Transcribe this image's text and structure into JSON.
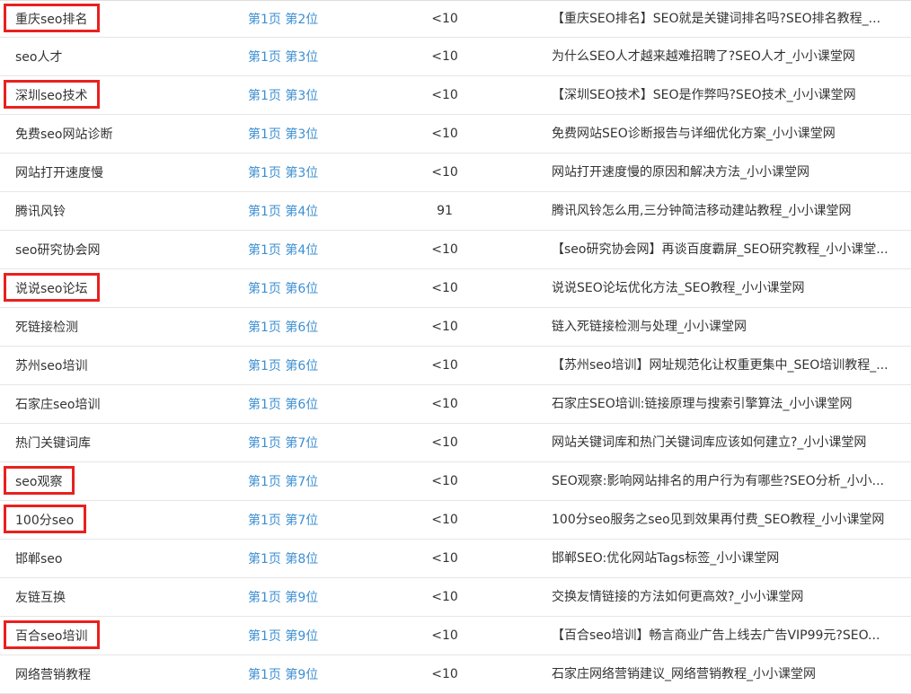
{
  "colors": {
    "link": "#3d8fd1",
    "text": "#333333",
    "highlight_box": "#e8211e",
    "row_border": "#e6e6e6"
  },
  "rows": [
    {
      "keyword": "重庆seo排名",
      "rank": "第1页 第2位",
      "index": "<10",
      "title": "【重庆SEO排名】SEO就是关键词排名吗?SEO排名教程_...",
      "highlighted": true
    },
    {
      "keyword": "seo人才",
      "rank": "第1页 第3位",
      "index": "<10",
      "title": "为什么SEO人才越来越难招聘了?SEO人才_小小课堂网",
      "highlighted": false
    },
    {
      "keyword": "深圳seo技术",
      "rank": "第1页 第3位",
      "index": "<10",
      "title": "【深圳SEO技术】SEO是作弊吗?SEO技术_小小课堂网",
      "highlighted": true
    },
    {
      "keyword": "免费seo网站诊断",
      "rank": "第1页 第3位",
      "index": "<10",
      "title": "免费网站SEO诊断报告与详细优化方案_小小课堂网",
      "highlighted": false
    },
    {
      "keyword": "网站打开速度慢",
      "rank": "第1页 第3位",
      "index": "<10",
      "title": "网站打开速度慢的原因和解决方法_小小课堂网",
      "highlighted": false
    },
    {
      "keyword": "腾讯风铃",
      "rank": "第1页 第4位",
      "index": "91",
      "title": "腾讯风铃怎么用,三分钟简洁移动建站教程_小小课堂网",
      "highlighted": false
    },
    {
      "keyword": "seo研究协会网",
      "rank": "第1页 第4位",
      "index": "<10",
      "title": "【seo研究协会网】再谈百度霸屏_SEO研究教程_小小课堂...",
      "highlighted": false
    },
    {
      "keyword": "说说seo论坛",
      "rank": "第1页 第6位",
      "index": "<10",
      "title": "说说SEO论坛优化方法_SEO教程_小小课堂网",
      "highlighted": true
    },
    {
      "keyword": "死链接检测",
      "rank": "第1页 第6位",
      "index": "<10",
      "title": "链入死链接检测与处理_小小课堂网",
      "highlighted": false
    },
    {
      "keyword": "苏州seo培训",
      "rank": "第1页 第6位",
      "index": "<10",
      "title": "【苏州seo培训】网址规范化让权重更集中_SEO培训教程_...",
      "highlighted": false
    },
    {
      "keyword": "石家庄seo培训",
      "rank": "第1页 第6位",
      "index": "<10",
      "title": "石家庄SEO培训:链接原理与搜索引擎算法_小小课堂网",
      "highlighted": false
    },
    {
      "keyword": "热门关键词库",
      "rank": "第1页 第7位",
      "index": "<10",
      "title": "网站关键词库和热门关键词库应该如何建立?_小小课堂网",
      "highlighted": false
    },
    {
      "keyword": "seo观察",
      "rank": "第1页 第7位",
      "index": "<10",
      "title": "SEO观察:影响网站排名的用户行为有哪些?SEO分析_小小...",
      "highlighted": true
    },
    {
      "keyword": "100分seo",
      "rank": "第1页 第7位",
      "index": "<10",
      "title": "100分seo服务之seo见到效果再付费_SEO教程_小小课堂网",
      "highlighted": true
    },
    {
      "keyword": "邯郸seo",
      "rank": "第1页 第8位",
      "index": "<10",
      "title": "邯郸SEO:优化网站Tags标签_小小课堂网",
      "highlighted": false
    },
    {
      "keyword": "友链互换",
      "rank": "第1页 第9位",
      "index": "<10",
      "title": "交换友情链接的方法如何更高效?_小小课堂网",
      "highlighted": false
    },
    {
      "keyword": "百合seo培训",
      "rank": "第1页 第9位",
      "index": "<10",
      "title": "【百合seo培训】畅言商业广告上线去广告VIP99元?SEO...",
      "highlighted": true
    },
    {
      "keyword": "网络营销教程",
      "rank": "第1页 第9位",
      "index": "<10",
      "title": "石家庄网络营销建议_网络营销教程_小小课堂网",
      "highlighted": false
    }
  ]
}
